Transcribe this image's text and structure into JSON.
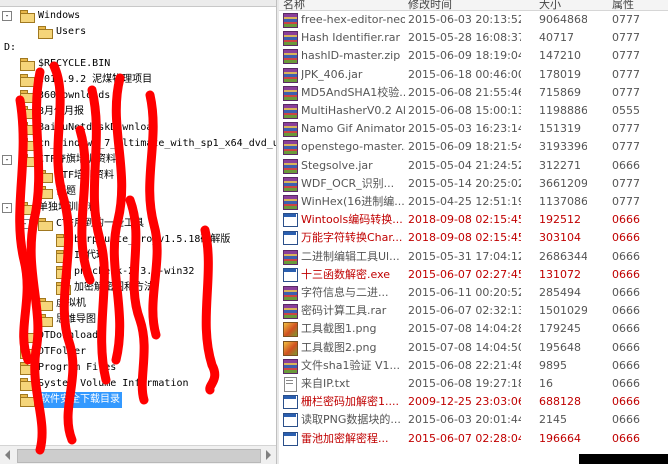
{
  "tree": {
    "nodes": [
      {
        "label": "Windows",
        "expander": "-",
        "depth": 0,
        "selected": false
      },
      {
        "label": "Users",
        "expander": "",
        "depth": 1,
        "selected": false
      },
      {
        "label": "D:",
        "expander": "",
        "depth": -1,
        "selected": false
      },
      {
        "label": "$RECYCLE.BIN",
        "expander": "",
        "depth": 0,
        "selected": false
      },
      {
        "label": "2018.9.2 泥煤物理项目",
        "expander": "",
        "depth": 0,
        "selected": false
      },
      {
        "label": "360Downloads",
        "expander": "",
        "depth": 0,
        "selected": false
      },
      {
        "label": "8月份月报",
        "expander": "",
        "depth": 0,
        "selected": false
      },
      {
        "label": "BaiduNetdiskDownload",
        "expander": "",
        "depth": 0,
        "selected": false
      },
      {
        "label": "cn_windows_7_ultimate_with_sp1_x64_dvd_u",
        "expander": "",
        "depth": 0,
        "selected": false
      },
      {
        "label": "CTF夺旗培训资料",
        "expander": "-",
        "depth": 0,
        "selected": false
      },
      {
        "label": "CTF培训资料",
        "expander": "",
        "depth": 1,
        "selected": false
      },
      {
        "label": "例题",
        "expander": "",
        "depth": 1,
        "selected": false
      },
      {
        "label": "单独培训资料",
        "expander": "-",
        "depth": 0,
        "selected": false
      },
      {
        "label": "CTF用到的一些工具",
        "expander": "-",
        "depth": 1,
        "selected": false
      },
      {
        "label": "burpsuite_pro_v1.5.18破解版",
        "expander": "",
        "depth": 2,
        "selected": false
      },
      {
        "label": "IP代理",
        "expander": "",
        "depth": 2,
        "selected": false
      },
      {
        "label": "pngcheck-2.3.0-win32",
        "expander": "",
        "depth": 2,
        "selected": false
      },
      {
        "label": "加密解密图和方法",
        "expander": "",
        "depth": 2,
        "selected": false
      },
      {
        "label": "虚拟机",
        "expander": "",
        "depth": 1,
        "selected": false
      },
      {
        "label": "思维导图",
        "expander": "",
        "depth": 1,
        "selected": false
      },
      {
        "label": "DTDownloads",
        "expander": "",
        "depth": 0,
        "selected": false
      },
      {
        "label": "DTFolder",
        "expander": "",
        "depth": 0,
        "selected": false
      },
      {
        "label": "Program Files",
        "expander": "",
        "depth": 0,
        "selected": false
      },
      {
        "label": "System Volume Information",
        "expander": "",
        "depth": 0,
        "selected": false
      },
      {
        "label": "软件安全下载目录",
        "expander": "",
        "depth": 0,
        "selected": true
      }
    ]
  },
  "list": {
    "columns": [
      "名称",
      "修改时间",
      "大小",
      "属性"
    ],
    "files": [
      {
        "name": "free-hex-editor-neo.zip",
        "date": "2015-06-03 20:13:52",
        "size": "9064868",
        "perm": "0777",
        "icon": "rar-archive-icon",
        "red": false
      },
      {
        "name": "Hash Identifier.rar",
        "date": "2015-05-28 16:08:37",
        "size": "40717",
        "perm": "0777",
        "icon": "rar-archive-icon",
        "red": false
      },
      {
        "name": "hashID-master.zip",
        "date": "2015-06-09 18:19:04",
        "size": "147210",
        "perm": "0777",
        "icon": "rar-archive-icon",
        "red": false
      },
      {
        "name": "JPK_406.jar",
        "date": "2015-06-18 00:46:00",
        "size": "178019",
        "perm": "0777",
        "icon": "rar-archive-icon",
        "red": false
      },
      {
        "name": "MD5AndSHA1校验...",
        "date": "2015-06-08 21:55:46",
        "size": "715869",
        "perm": "0777",
        "icon": "rar-archive-icon",
        "red": false
      },
      {
        "name": "MultiHasherV0.2 Al...",
        "date": "2015-06-08 15:00:13",
        "size": "1198886",
        "perm": "0555",
        "icon": "rar-archive-icon",
        "red": false
      },
      {
        "name": "Namo Gif Animator(...",
        "date": "2015-05-03 16:23:14",
        "size": "151319",
        "perm": "0777",
        "icon": "rar-archive-icon",
        "red": false
      },
      {
        "name": "openstego-master.zip",
        "date": "2015-06-09 18:21:54",
        "size": "3193396",
        "perm": "0777",
        "icon": "rar-archive-icon",
        "red": false
      },
      {
        "name": "Stegsolve.jar",
        "date": "2015-05-04 21:24:52",
        "size": "312271",
        "perm": "0666",
        "icon": "rar-archive-icon",
        "red": false
      },
      {
        "name": "WDF_OCR_识别...",
        "date": "2015-05-14 20:25:02",
        "size": "3661209",
        "perm": "0777",
        "icon": "rar-archive-icon",
        "red": false
      },
      {
        "name": "WinHex(16进制编...",
        "date": "2015-04-25 12:51:19",
        "size": "1137086",
        "perm": "0777",
        "icon": "rar-archive-icon",
        "red": false
      },
      {
        "name": "Wintools编码转换...",
        "date": "2018-09-08 02:15:45",
        "size": "192512",
        "perm": "0666",
        "icon": "exe-file-icon",
        "red": true
      },
      {
        "name": "万能字符转换Char...",
        "date": "2018-09-08 02:15:45",
        "size": "303104",
        "perm": "0666",
        "icon": "exe-file-icon",
        "red": true
      },
      {
        "name": "二进制编辑工具Ul...",
        "date": "2015-05-31 17:04:12",
        "size": "2686344",
        "perm": "0666",
        "icon": "rar-archive-icon",
        "red": false
      },
      {
        "name": "十三函数解密.exe",
        "date": "2015-06-07 02:27:45",
        "size": "131072",
        "perm": "0666",
        "icon": "exe-file-icon",
        "red": true
      },
      {
        "name": "字符信息与二进...",
        "date": "2015-06-11 00:20:52",
        "size": "285494",
        "perm": "0666",
        "icon": "rar-archive-icon",
        "red": false
      },
      {
        "name": "密码计算工具.rar",
        "date": "2015-06-07 02:32:13",
        "size": "1501029",
        "perm": "0666",
        "icon": "rar-archive-icon",
        "red": false
      },
      {
        "name": "工具截图1.png",
        "date": "2015-07-08 14:04:28",
        "size": "179245",
        "perm": "0666",
        "icon": "image-file-icon",
        "red": false
      },
      {
        "name": "工具截图2.png",
        "date": "2015-07-08 14:04:50",
        "size": "195648",
        "perm": "0666",
        "icon": "image-file-icon",
        "red": false
      },
      {
        "name": "文件sha1验证 V1...",
        "date": "2015-06-08 22:21:48",
        "size": "9895",
        "perm": "0666",
        "icon": "rar-archive-icon",
        "red": false
      },
      {
        "name": "来自IP.txt",
        "date": "2015-06-08 19:27:18",
        "size": "16",
        "perm": "0666",
        "icon": "text-file-icon",
        "red": false
      },
      {
        "name": "栅栏密码加解密1....",
        "date": "2009-12-25 23:03:06",
        "size": "688128",
        "perm": "0666",
        "icon": "exe-file-icon",
        "red": true
      },
      {
        "name": "读取PNG数据块的...",
        "date": "2015-06-03 20:01:44",
        "size": "2145",
        "perm": "0666",
        "icon": "exe-file-icon",
        "red": false
      },
      {
        "name": "雷池加密解密程...",
        "date": "2015-06-07 02:28:04",
        "size": "196664",
        "perm": "0666",
        "icon": "exe-file-icon",
        "red": true
      }
    ]
  },
  "colors": {
    "red_text": "#c00000",
    "selection": "#3399ff",
    "scribble": "#ff0000"
  }
}
